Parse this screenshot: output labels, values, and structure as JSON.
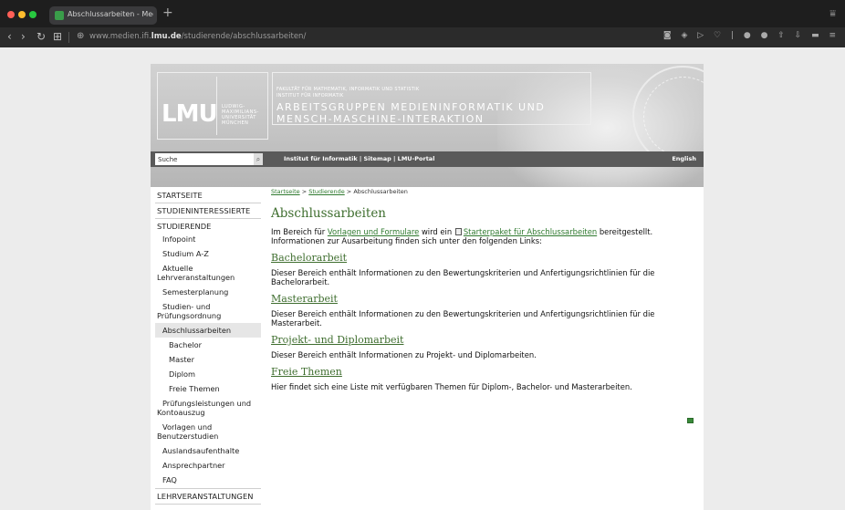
{
  "browser": {
    "tab_title": "Abschlussarbeiten - Medieninformatik",
    "new_tab": "+",
    "url_prefix": "www.medien.ifi.",
    "url_domain": "lmu.de",
    "url_path": "/studierende/abschlussarbeiten/"
  },
  "header": {
    "logo": "LMU",
    "university": "LUDWIG-MAXIMILIANS-UNIVERSITÄT MÜNCHEN",
    "faculty": "FAKULTÄT FÜR MATHEMATIK, INFORMATIK UND STATISTIK",
    "institute": "INSTITUT FÜR INFORMATIK",
    "group_line1": "ARBEITSGRUPPEN MEDIENINFORMATIK UND",
    "group_line2": "MENSCH-MASCHINE-INTERAKTION",
    "search_value": "Suche",
    "quick_links": "Institut für Informatik | Sitemap | LMU-Portal",
    "english": "English"
  },
  "sidebar": {
    "startseite": "STARTSEITE",
    "studieninteressierte": "STUDIENINTERESSIERTE",
    "studierende": "STUDIERENDE",
    "infopoint": "Infopoint",
    "studium_az": "Studium A-Z",
    "aktuelle": "Aktuelle Lehrveranstaltungen",
    "semesterplanung": "Semesterplanung",
    "pruefungsordnung": "Studien- und Prüfungsordnung",
    "abschlussarbeiten": "Abschlussarbeiten",
    "bachelor": "Bachelor",
    "master": "Master",
    "diplom": "Diplom",
    "freie_themen": "Freie Themen",
    "pruefungsleistungen": "Prüfungsleistungen und Kontoauszug",
    "vorlagen": "Vorlagen und Benutzerstudien",
    "auslandsaufenthalte": "Auslandsaufenthalte",
    "ansprechpartner": "Ansprechpartner",
    "faq": "FAQ",
    "lehrveranstaltungen": "LEHRVERANSTALTUNGEN"
  },
  "breadcrumb": {
    "home": "Startseite",
    "sep1": " > ",
    "studierende": "Studierende",
    "sep2": " > ",
    "current": "Abschlussarbeiten"
  },
  "content": {
    "title": "Abschlussarbeiten",
    "intro_a": "Im Bereich für ",
    "intro_link1": "Vorlagen und Formulare",
    "intro_b": " wird ein ",
    "intro_link2": "Starterpaket für Abschlussarbeiten",
    "intro_c": " bereitgestellt. Informationen zur Ausarbeitung finden sich unter den folgenden Links:",
    "bachelor_head": "Bachelorarbeit",
    "bachelor_text": "Dieser Bereich enthält Informationen zu den Bewertungskriterien und Anfertigungsrichtlinien für die Bachelorarbeit.",
    "master_head": "Masterarbeit",
    "master_text": "Dieser Bereich enthält Informationen zu den Bewertungskriterien und Anfertigungsrichtlinien für die Masterarbeit.",
    "projekt_head": "Projekt- und Diplomarbeit",
    "projekt_text": "Dieser Bereich enthält Informationen zu Projekt- und Diplomarbeiten.",
    "freie_head": "Freie Themen",
    "freie_text": "Hier findet sich eine Liste mit verfügbaren Themen für Diplom-, Bachelor- und Masterarbeiten."
  }
}
